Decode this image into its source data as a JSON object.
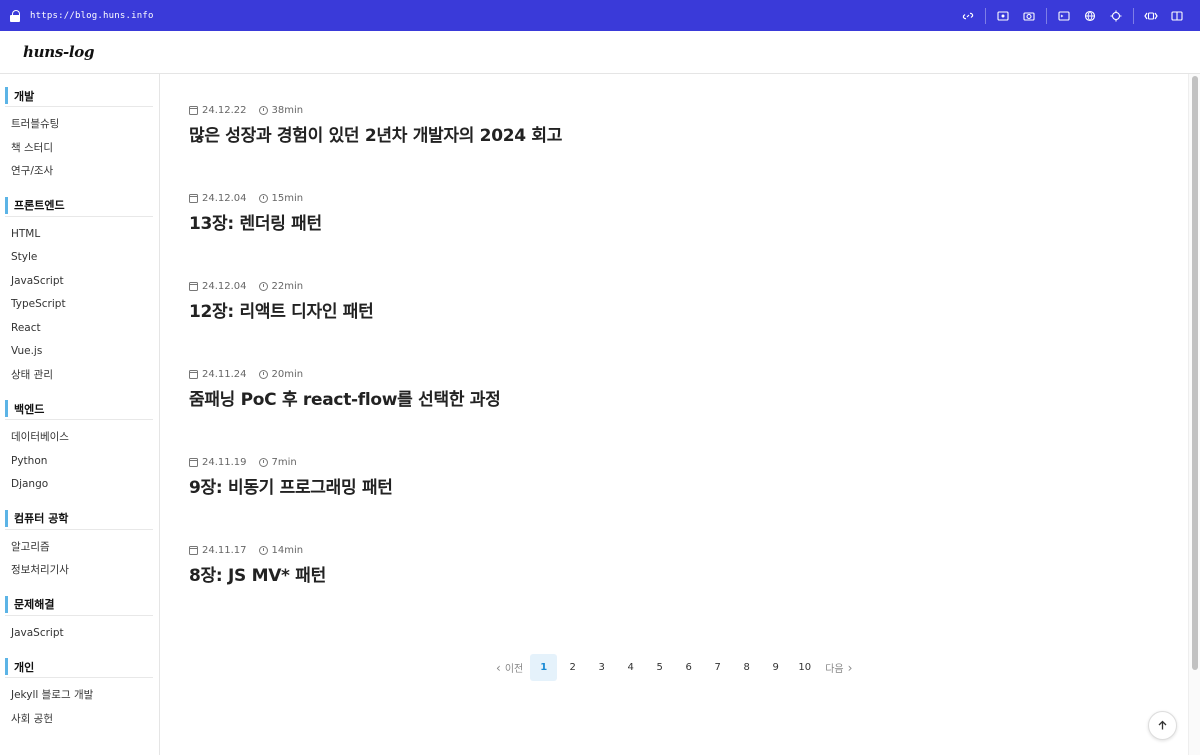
{
  "browser": {
    "url": "https://blog.huns.info",
    "tools": [
      "link-icon",
      "screencast-icon",
      "camera-icon",
      "terminal-icon",
      "globe-icon",
      "crosshair-icon",
      "devices-icon",
      "sidebar-icon"
    ]
  },
  "header": {
    "logo": "huns-log"
  },
  "sidebar": {
    "categories": [
      {
        "title": "개발",
        "items": [
          "트러블슈팅",
          "책 스터디",
          "연구/조사"
        ]
      },
      {
        "title": "프론트엔드",
        "items": [
          "HTML",
          "Style",
          "JavaScript",
          "TypeScript",
          "React",
          "Vue.js",
          "상태 관리"
        ]
      },
      {
        "title": "백엔드",
        "items": [
          "데이터베이스",
          "Python",
          "Django"
        ]
      },
      {
        "title": "컴퓨터 공학",
        "items": [
          "알고리즘",
          "정보처리기사"
        ]
      },
      {
        "title": "문제해결",
        "items": [
          "JavaScript"
        ]
      },
      {
        "title": "개인",
        "items": [
          "Jekyll 블로그 개발",
          "사회 공헌"
        ]
      }
    ]
  },
  "posts": [
    {
      "date": "24.12.22",
      "readtime": "38min",
      "title": "많은 성장과 경험이 있던 2년차 개발자의 2024 회고"
    },
    {
      "date": "24.12.04",
      "readtime": "15min",
      "title": "13장: 렌더링 패턴"
    },
    {
      "date": "24.12.04",
      "readtime": "22min",
      "title": "12장: 리액트 디자인 패턴"
    },
    {
      "date": "24.11.24",
      "readtime": "20min",
      "title": "줌패닝 PoC 후 react-flow를 선택한 과정"
    },
    {
      "date": "24.11.19",
      "readtime": "7min",
      "title": "9장: 비동기 프로그래밍 패턴"
    },
    {
      "date": "24.11.17",
      "readtime": "14min",
      "title": "8장: JS MV* 패턴"
    }
  ],
  "pagination": {
    "prev_label": "이전",
    "next_label": "다음",
    "pages": [
      "1",
      "2",
      "3",
      "4",
      "5",
      "6",
      "7",
      "8",
      "9",
      "10"
    ],
    "current": "1"
  },
  "colors": {
    "browser_bar": "#3a3ad9",
    "category_accent": "#5cb4e6",
    "active_page_bg": "#e5f2fb",
    "active_page_text": "#1a8ad4"
  }
}
